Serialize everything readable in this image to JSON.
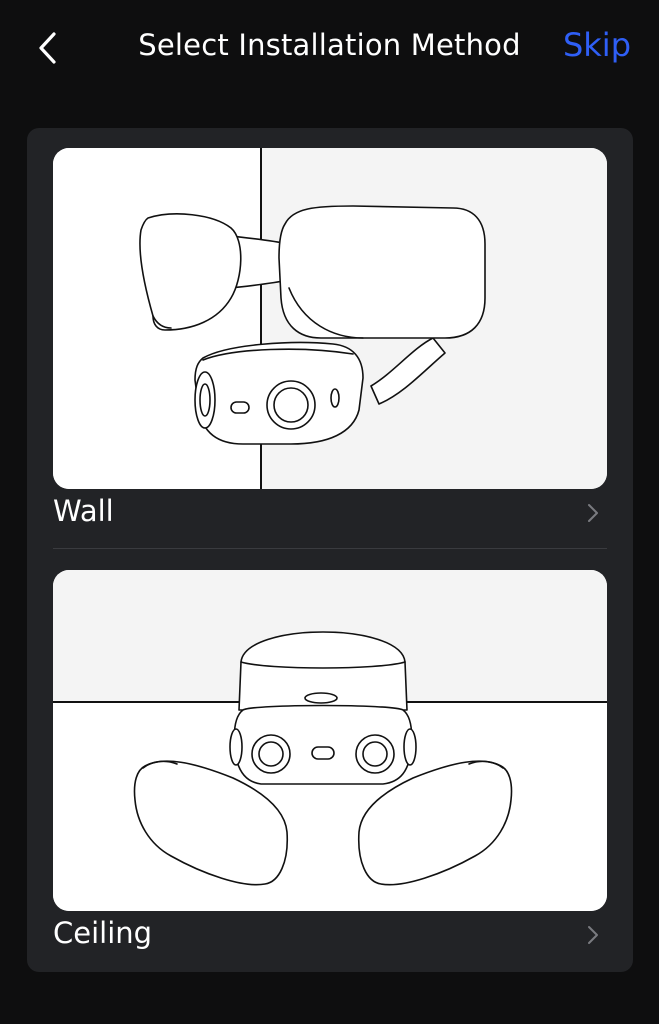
{
  "header": {
    "title": "Select Installation Method",
    "skip_label": "Skip",
    "back_icon": "chevron-left-icon"
  },
  "options": [
    {
      "label": "Wall",
      "icon": "chevron-right-icon"
    },
    {
      "label": "Ceiling",
      "icon": "chevron-right-icon"
    }
  ],
  "colors": {
    "background": "#0e0e0f",
    "card": "#222326",
    "accent": "#2f5ff6",
    "text": "#ffffff",
    "chevron": "#7a7b80"
  }
}
